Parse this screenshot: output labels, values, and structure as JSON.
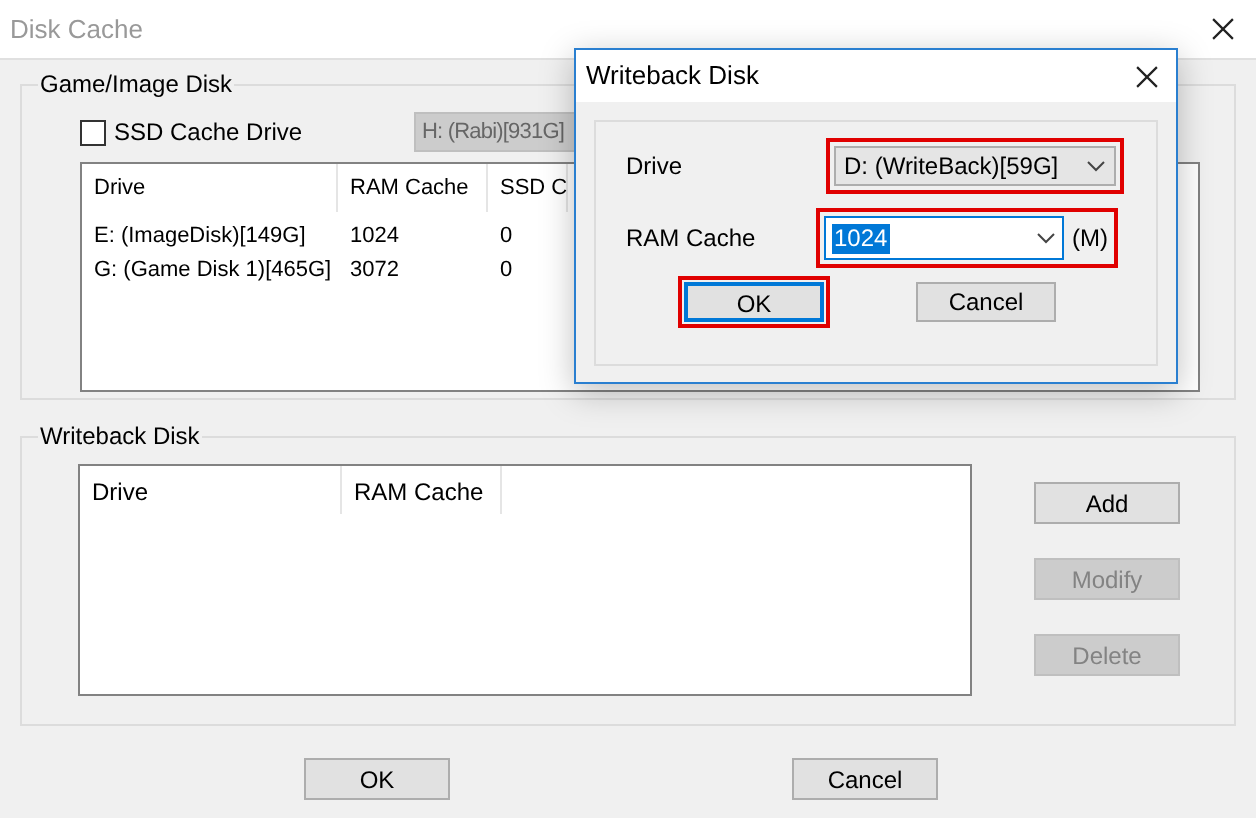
{
  "window": {
    "title": "Disk Cache",
    "active": false
  },
  "game_image_disk": {
    "title": "Game/Image Disk",
    "ssd_cache_drive": {
      "label": "SSD Cache Drive",
      "checked": false
    },
    "ssd_drive_select": {
      "value": "H: (Rabi)[931G]",
      "disabled": true
    },
    "table": {
      "columns": [
        "Drive",
        "RAM Cache",
        "SSD C"
      ],
      "rows": [
        {
          "cells": [
            "E: (ImageDisk)[149G]",
            "1024",
            "0"
          ]
        },
        {
          "cells": [
            "G: (Game Disk 1)[465G]",
            "3072",
            "0"
          ]
        }
      ]
    }
  },
  "writeback_disk": {
    "title": "Writeback Disk",
    "table": {
      "columns": [
        "Drive",
        "RAM Cache"
      ]
    },
    "buttons": [
      {
        "label": "Add",
        "disabled": false
      },
      {
        "label": "Modify",
        "disabled": true
      },
      {
        "label": "Delete",
        "disabled": true
      }
    ]
  },
  "footer_buttons": [
    "OK",
    "Cancel"
  ],
  "dialog": {
    "title": "Writeback Disk",
    "drive": {
      "label": "Drive",
      "value": "D: (WriteBack)[59G]",
      "highlighted": true
    },
    "ram_cache": {
      "label": "RAM Cache",
      "value": "1024",
      "unit": "(M)",
      "highlighted": true
    },
    "buttons": [
      {
        "label": "OK",
        "highlighted": true,
        "focused": true
      },
      {
        "label": "Cancel",
        "highlighted": false,
        "focused": false
      }
    ]
  }
}
